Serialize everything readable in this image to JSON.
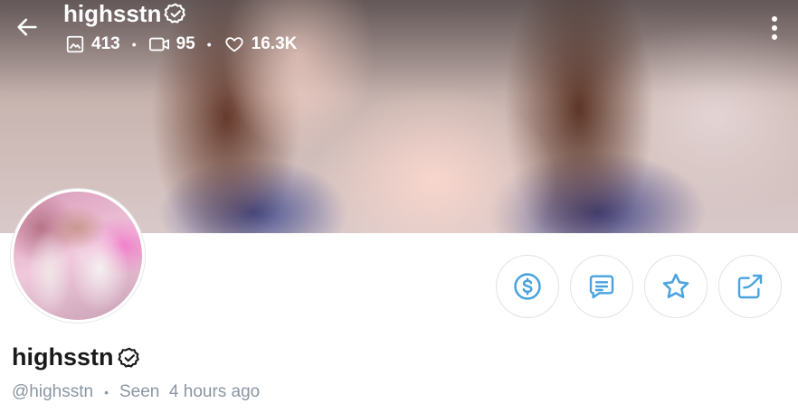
{
  "header": {
    "username": "highsstn",
    "stats": {
      "photos": "413",
      "videos": "95",
      "likes": "16.3K"
    }
  },
  "profile": {
    "name": "highsstn",
    "handle": "@highsstn",
    "last_seen": "Seen  4 hours ago"
  },
  "colors": {
    "accent": "#4aa3df",
    "border": "#dfe3e6",
    "muted_text": "#8a96a3"
  },
  "icons": {
    "back": "arrow-left-icon",
    "verified": "verified-badge-icon",
    "photos": "image-icon",
    "videos": "video-icon",
    "likes": "heart-icon",
    "more": "more-vertical-icon",
    "tip": "dollar-circle-icon",
    "message": "message-icon",
    "favorite": "star-icon",
    "share": "share-icon"
  }
}
